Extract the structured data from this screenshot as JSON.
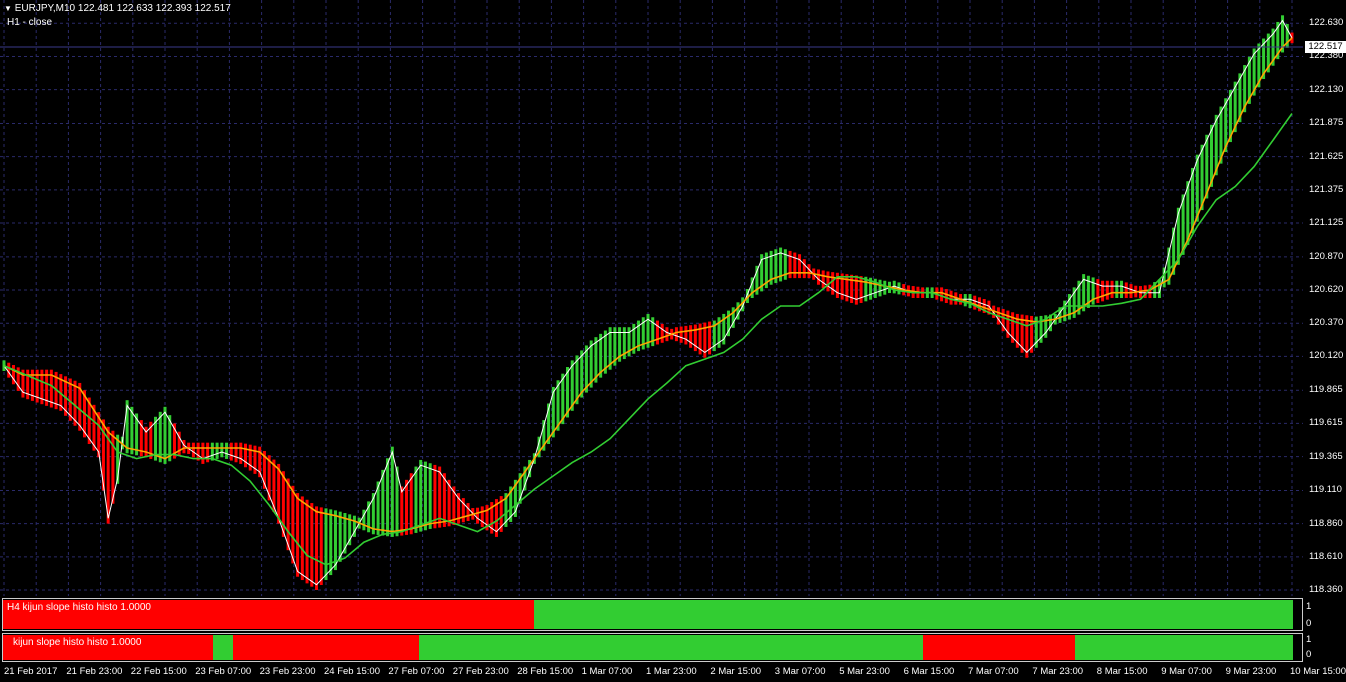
{
  "header": {
    "symbol_line": "EURJPY,M10  122.481 122.633 122.393 122.517",
    "indicator_line": "H1 - close",
    "menu_icon": "triangle-down-icon"
  },
  "price_axis": {
    "current_price": "122.517",
    "labels": [
      "122.630",
      "122.380",
      "122.130",
      "121.875",
      "121.625",
      "121.375",
      "121.125",
      "120.870",
      "120.620",
      "120.370",
      "120.120",
      "119.865",
      "119.615",
      "119.365",
      "119.110",
      "118.860",
      "118.610",
      "118.360"
    ]
  },
  "colors": {
    "background": "#000000",
    "grid": "#2a2a6a",
    "bull": "#32cd32",
    "bear": "#ff0000",
    "upper_line": "#ffa500",
    "lower_line": "#32cd32",
    "price_line": "#ffffff"
  },
  "subpanels": [
    {
      "label": "H4  kijun slope histo histo  1.0000",
      "scale_top": "1",
      "scale_bottom": "0",
      "segments": [
        {
          "from": 0.0,
          "to": 0.409,
          "state": "bear"
        },
        {
          "from": 0.409,
          "to": 0.993,
          "state": "bull"
        }
      ]
    },
    {
      "label": "kijun slope histo histo  1.0000",
      "scale_top": "1",
      "scale_bottom": "0",
      "segments": [
        {
          "from": 0.0,
          "to": 0.162,
          "state": "bear"
        },
        {
          "from": 0.162,
          "to": 0.177,
          "state": "bull"
        },
        {
          "from": 0.177,
          "to": 0.32,
          "state": "bear"
        },
        {
          "from": 0.32,
          "to": 0.708,
          "state": "bull"
        },
        {
          "from": 0.708,
          "to": 0.825,
          "state": "bear"
        },
        {
          "from": 0.825,
          "to": 0.993,
          "state": "bull"
        }
      ]
    }
  ],
  "time_axis": {
    "labels": [
      "21 Feb 2017",
      "21 Feb 23:00",
      "22 Feb 15:00",
      "23 Feb 07:00",
      "23 Feb 23:00",
      "24 Feb 15:00",
      "27 Feb 07:00",
      "27 Feb 23:00",
      "28 Feb 15:00",
      "1 Mar 07:00",
      "1 Mar 23:00",
      "2 Mar 15:00",
      "3 Mar 07:00",
      "5 Mar 23:00",
      "6 Mar 15:00",
      "7 Mar 07:00",
      "7 Mar 23:00",
      "8 Mar 15:00",
      "9 Mar 07:00",
      "9 Mar 23:00",
      "10 Mar 15:00"
    ]
  },
  "chart_data": {
    "type": "line",
    "y_range": [
      118.36,
      122.73
    ],
    "series": [
      {
        "name": "close",
        "points": [
          [
            0,
            120.05
          ],
          [
            2,
            119.85
          ],
          [
            4,
            119.8
          ],
          [
            6,
            119.75
          ],
          [
            8,
            119.6
          ],
          [
            10,
            119.4
          ],
          [
            11,
            118.9
          ],
          [
            12,
            119.2
          ],
          [
            13,
            119.75
          ],
          [
            15,
            119.55
          ],
          [
            17,
            119.7
          ],
          [
            19,
            119.45
          ],
          [
            21,
            119.35
          ],
          [
            23,
            119.4
          ],
          [
            25,
            119.35
          ],
          [
            27,
            119.25
          ],
          [
            29,
            118.9
          ],
          [
            31,
            118.5
          ],
          [
            33,
            118.4
          ],
          [
            35,
            118.55
          ],
          [
            37,
            118.8
          ],
          [
            39,
            119.05
          ],
          [
            41,
            119.4
          ],
          [
            42,
            119.1
          ],
          [
            44,
            119.3
          ],
          [
            46,
            119.25
          ],
          [
            48,
            119.05
          ],
          [
            50,
            118.9
          ],
          [
            52,
            118.8
          ],
          [
            54,
            118.95
          ],
          [
            56,
            119.35
          ],
          [
            58,
            119.85
          ],
          [
            60,
            120.05
          ],
          [
            62,
            120.2
          ],
          [
            64,
            120.3
          ],
          [
            66,
            120.3
          ],
          [
            68,
            120.4
          ],
          [
            70,
            120.3
          ],
          [
            72,
            120.25
          ],
          [
            74,
            120.15
          ],
          [
            76,
            120.25
          ],
          [
            78,
            120.5
          ],
          [
            80,
            120.85
          ],
          [
            82,
            120.9
          ],
          [
            84,
            120.85
          ],
          [
            86,
            120.7
          ],
          [
            88,
            120.6
          ],
          [
            90,
            120.55
          ],
          [
            92,
            120.6
          ],
          [
            94,
            120.65
          ],
          [
            96,
            120.6
          ],
          [
            98,
            120.6
          ],
          [
            100,
            120.55
          ],
          [
            102,
            120.55
          ],
          [
            104,
            120.5
          ],
          [
            106,
            120.3
          ],
          [
            108,
            120.15
          ],
          [
            110,
            120.3
          ],
          [
            112,
            120.5
          ],
          [
            114,
            120.7
          ],
          [
            116,
            120.65
          ],
          [
            118,
            120.65
          ],
          [
            120,
            120.6
          ],
          [
            122,
            120.6
          ],
          [
            124,
            121.2
          ],
          [
            126,
            121.6
          ],
          [
            128,
            121.9
          ],
          [
            130,
            122.15
          ],
          [
            132,
            122.4
          ],
          [
            134,
            122.55
          ],
          [
            135,
            122.65
          ],
          [
            136,
            122.52
          ]
        ]
      },
      {
        "name": "upper",
        "points": [
          [
            0,
            120.05
          ],
          [
            2,
            119.98
          ],
          [
            5,
            119.98
          ],
          [
            8,
            119.88
          ],
          [
            11,
            119.55
          ],
          [
            13,
            119.43
          ],
          [
            15,
            119.4
          ],
          [
            17,
            119.35
          ],
          [
            19,
            119.43
          ],
          [
            21,
            119.43
          ],
          [
            23,
            119.43
          ],
          [
            25,
            119.43
          ],
          [
            27,
            119.4
          ],
          [
            29,
            119.27
          ],
          [
            31,
            119.05
          ],
          [
            33,
            118.95
          ],
          [
            35,
            118.92
          ],
          [
            37,
            118.88
          ],
          [
            39,
            118.82
          ],
          [
            41,
            118.8
          ],
          [
            43,
            118.82
          ],
          [
            45,
            118.86
          ],
          [
            47,
            118.88
          ],
          [
            49,
            118.92
          ],
          [
            51,
            118.96
          ],
          [
            53,
            119.05
          ],
          [
            55,
            119.25
          ],
          [
            57,
            119.45
          ],
          [
            59,
            119.65
          ],
          [
            61,
            119.85
          ],
          [
            63,
            120.0
          ],
          [
            65,
            120.12
          ],
          [
            67,
            120.2
          ],
          [
            69,
            120.25
          ],
          [
            71,
            120.3
          ],
          [
            73,
            120.32
          ],
          [
            75,
            120.35
          ],
          [
            77,
            120.45
          ],
          [
            79,
            120.6
          ],
          [
            81,
            120.7
          ],
          [
            83,
            120.75
          ],
          [
            85,
            120.75
          ],
          [
            87,
            120.72
          ],
          [
            89,
            120.7
          ],
          [
            91,
            120.68
          ],
          [
            93,
            120.65
          ],
          [
            95,
            120.62
          ],
          [
            97,
            120.6
          ],
          [
            99,
            120.6
          ],
          [
            101,
            120.55
          ],
          [
            103,
            120.5
          ],
          [
            105,
            120.45
          ],
          [
            107,
            120.4
          ],
          [
            109,
            120.38
          ],
          [
            111,
            120.4
          ],
          [
            113,
            120.45
          ],
          [
            115,
            120.55
          ],
          [
            117,
            120.6
          ],
          [
            119,
            120.6
          ],
          [
            121,
            120.62
          ],
          [
            123,
            120.7
          ],
          [
            125,
            121.0
          ],
          [
            127,
            121.35
          ],
          [
            129,
            121.7
          ],
          [
            131,
            122.0
          ],
          [
            133,
            122.25
          ],
          [
            135,
            122.45
          ],
          [
            136,
            122.52
          ]
        ]
      },
      {
        "name": "lower",
        "points": [
          [
            0,
            120.05
          ],
          [
            5,
            119.9
          ],
          [
            10,
            119.6
          ],
          [
            12,
            119.4
          ],
          [
            14,
            119.35
          ],
          [
            16,
            119.38
          ],
          [
            18,
            119.38
          ],
          [
            20,
            119.35
          ],
          [
            22,
            119.35
          ],
          [
            24,
            119.3
          ],
          [
            26,
            119.18
          ],
          [
            28,
            119.0
          ],
          [
            30,
            118.8
          ],
          [
            32,
            118.62
          ],
          [
            34,
            118.55
          ],
          [
            36,
            118.6
          ],
          [
            38,
            118.72
          ],
          [
            40,
            118.78
          ],
          [
            42,
            118.8
          ],
          [
            44,
            118.85
          ],
          [
            46,
            118.9
          ],
          [
            48,
            118.85
          ],
          [
            50,
            118.8
          ],
          [
            52,
            118.88
          ],
          [
            54,
            119.0
          ],
          [
            56,
            119.12
          ],
          [
            58,
            119.22
          ],
          [
            60,
            119.32
          ],
          [
            62,
            119.4
          ],
          [
            64,
            119.5
          ],
          [
            66,
            119.65
          ],
          [
            68,
            119.8
          ],
          [
            70,
            119.92
          ],
          [
            72,
            120.05
          ],
          [
            74,
            120.1
          ],
          [
            76,
            120.15
          ],
          [
            78,
            120.25
          ],
          [
            80,
            120.4
          ],
          [
            82,
            120.5
          ],
          [
            84,
            120.5
          ],
          [
            86,
            120.6
          ],
          [
            88,
            120.72
          ],
          [
            90,
            120.72
          ],
          [
            92,
            120.68
          ],
          [
            94,
            120.62
          ],
          [
            96,
            120.6
          ],
          [
            98,
            120.6
          ],
          [
            100,
            120.55
          ],
          [
            102,
            120.52
          ],
          [
            104,
            120.45
          ],
          [
            106,
            120.4
          ],
          [
            108,
            120.35
          ],
          [
            110,
            120.4
          ],
          [
            112,
            120.5
          ],
          [
            114,
            120.5
          ],
          [
            116,
            120.5
          ],
          [
            118,
            120.52
          ],
          [
            120,
            120.55
          ],
          [
            122,
            120.7
          ],
          [
            124,
            120.85
          ],
          [
            126,
            121.1
          ],
          [
            128,
            121.3
          ],
          [
            130,
            121.4
          ],
          [
            132,
            121.55
          ],
          [
            134,
            121.75
          ],
          [
            136,
            121.95
          ]
        ]
      }
    ]
  }
}
